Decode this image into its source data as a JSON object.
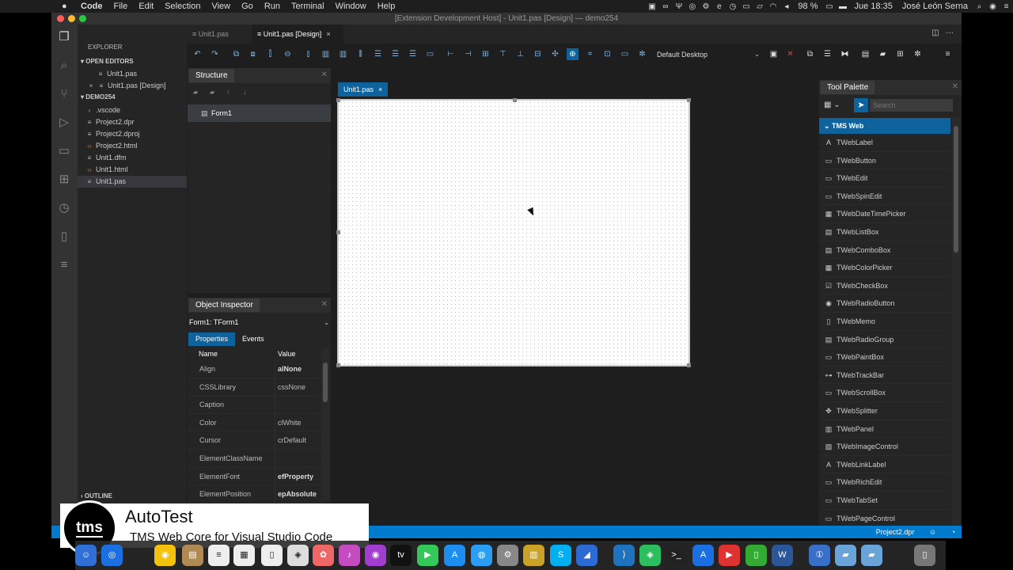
{
  "menubar": {
    "app": "Code",
    "items": [
      "File",
      "Edit",
      "Selection",
      "View",
      "Go",
      "Run",
      "Terminal",
      "Window",
      "Help"
    ],
    "battery": "98 %",
    "clock": "Jue 18:35",
    "user": "José León Serna"
  },
  "window": {
    "title": "[Extension Development Host] - Unit1.pas [Design] — demo254"
  },
  "explorer": {
    "header": "EXPLORER",
    "open_editors_label": "OPEN EDITORS",
    "open_editors": [
      "Unit1.pas",
      "Unit1.pas [Design]"
    ],
    "folder_label": "DEMO254",
    "files": [
      {
        "name": ".vscode",
        "icon": "chevron-right-icon"
      },
      {
        "name": "Project2.dpr",
        "icon": "lines-icon"
      },
      {
        "name": "Project2.dproj",
        "icon": "lines-icon"
      },
      {
        "name": "Project2.html",
        "icon": "html-icon"
      },
      {
        "name": "Unit1.dfm",
        "icon": "lines-icon"
      },
      {
        "name": "Unit1.html",
        "icon": "html-icon"
      },
      {
        "name": "Unit1.pas",
        "icon": "lines-icon"
      }
    ],
    "outline_label": "OUTLINE"
  },
  "editor": {
    "tabs": [
      {
        "label": "Unit1.pas"
      },
      {
        "label": "Unit1.pas [Design]",
        "close": "×"
      }
    ],
    "desktop_select": "Default Desktop"
  },
  "structure": {
    "title": "Structure",
    "root": "Form1"
  },
  "inspector": {
    "title": "Object Inspector",
    "selected": "Form1: TForm1",
    "tabs": [
      "Properties",
      "Events"
    ],
    "col_name": "Name",
    "col_value": "Value",
    "rows": [
      {
        "name": "Align",
        "value": "alNone",
        "bold": true
      },
      {
        "name": "CSSLibrary",
        "value": "cssNone",
        "bold": false
      },
      {
        "name": "Caption",
        "value": "",
        "bold": false
      },
      {
        "name": "Color",
        "value": "clWhite",
        "bold": false
      },
      {
        "name": "Cursor",
        "value": "crDefault",
        "bold": false
      },
      {
        "name": "ElementClassName",
        "value": "",
        "bold": false
      },
      {
        "name": "ElementFont",
        "value": "efProperty",
        "bold": true
      },
      {
        "name": "ElementPosition",
        "value": "epAbsolute",
        "bold": true
      }
    ]
  },
  "designer": {
    "tab_label": "Unit1.pas",
    "tab_close": "×"
  },
  "palette": {
    "title": "Tool Palette",
    "search_placeholder": "Search",
    "category": "TMS Web",
    "items": [
      {
        "name": "TWebLabel",
        "icon": "A"
      },
      {
        "name": "TWebButton",
        "icon": "▭"
      },
      {
        "name": "TWebEdit",
        "icon": "▭"
      },
      {
        "name": "TWebSpinEdit",
        "icon": "▭"
      },
      {
        "name": "TWebDateTimePicker",
        "icon": "▦"
      },
      {
        "name": "TWebListBox",
        "icon": "▤"
      },
      {
        "name": "TWebComboBox",
        "icon": "▤"
      },
      {
        "name": "TWebColorPicker",
        "icon": "▦"
      },
      {
        "name": "TWebCheckBox",
        "icon": "☑"
      },
      {
        "name": "TWebRadioButton",
        "icon": "◉"
      },
      {
        "name": "TWebMemo",
        "icon": "▯"
      },
      {
        "name": "TWebRadioGroup",
        "icon": "▤"
      },
      {
        "name": "TWebPaintBox",
        "icon": "▭"
      },
      {
        "name": "TWebTrackBar",
        "icon": "⊶"
      },
      {
        "name": "TWebScrollBox",
        "icon": "▭"
      },
      {
        "name": "TWebSplitter",
        "icon": "✥"
      },
      {
        "name": "TWebPanel",
        "icon": "▥"
      },
      {
        "name": "TWebImageControl",
        "icon": "▨"
      },
      {
        "name": "TWebLinkLabel",
        "icon": "A"
      },
      {
        "name": "TWebRichEdit",
        "icon": "▭"
      },
      {
        "name": "TWebTabSet",
        "icon": "▭"
      },
      {
        "name": "TWebPageControl",
        "icon": "▭"
      }
    ]
  },
  "statusbar": {
    "project": "Project2.dpr"
  },
  "overlay": {
    "logo": "tms",
    "title": "AutoTest",
    "subtitle": "TMS Web Core for Visual Studio Code"
  },
  "colors": {
    "accent": "#007acc",
    "selection": "#0e639c",
    "background": "#1e1e1e"
  }
}
